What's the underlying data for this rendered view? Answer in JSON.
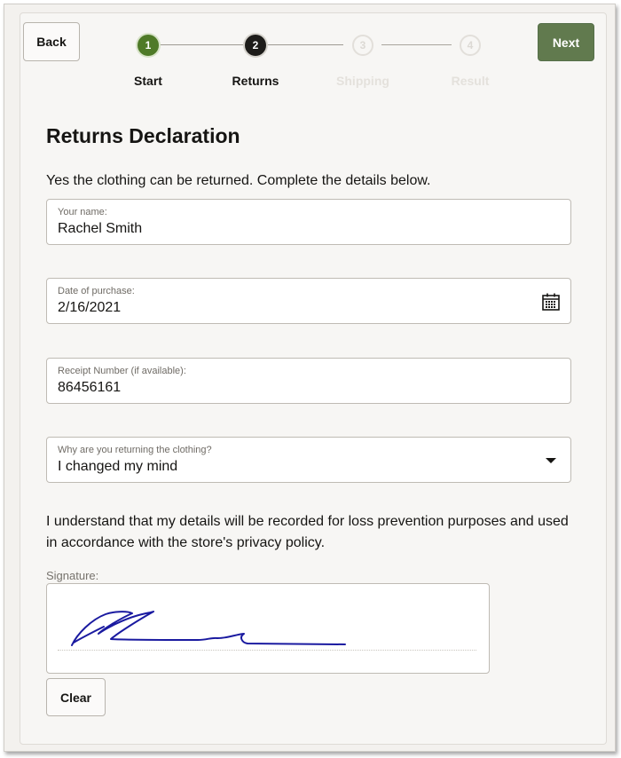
{
  "header": {
    "back_label": "Back",
    "next_label": "Next"
  },
  "stepper": {
    "steps": [
      {
        "number": "1",
        "label": "Start",
        "state": "done"
      },
      {
        "number": "2",
        "label": "Returns",
        "state": "current"
      },
      {
        "number": "3",
        "label": "Shipping",
        "state": "future"
      },
      {
        "number": "4",
        "label": "Result",
        "state": "future"
      }
    ]
  },
  "form": {
    "title": "Returns Declaration",
    "intro": "Yes the clothing can be returned. Complete the details below.",
    "name": {
      "label": "Your name:",
      "value": "Rachel Smith"
    },
    "date": {
      "label": "Date of purchase:",
      "value": "2/16/2021",
      "icon": "calendar-icon"
    },
    "receipt": {
      "label": "Receipt Number (if available):",
      "value": "86456161"
    },
    "reason": {
      "label": "Why are you returning the clothing?",
      "value": "I changed my mind",
      "icon": "caret-down-icon"
    },
    "notice": "I understand that my details will be recorded for loss prevention purposes and used in accordance with the store's privacy policy.",
    "signature_label": "Signature:",
    "clear_label": "Clear"
  },
  "colors": {
    "accent_green": "#617a4e",
    "step_done": "#4f7a28",
    "step_current": "#1d1c1a",
    "signature_ink": "#1a1aa0"
  }
}
